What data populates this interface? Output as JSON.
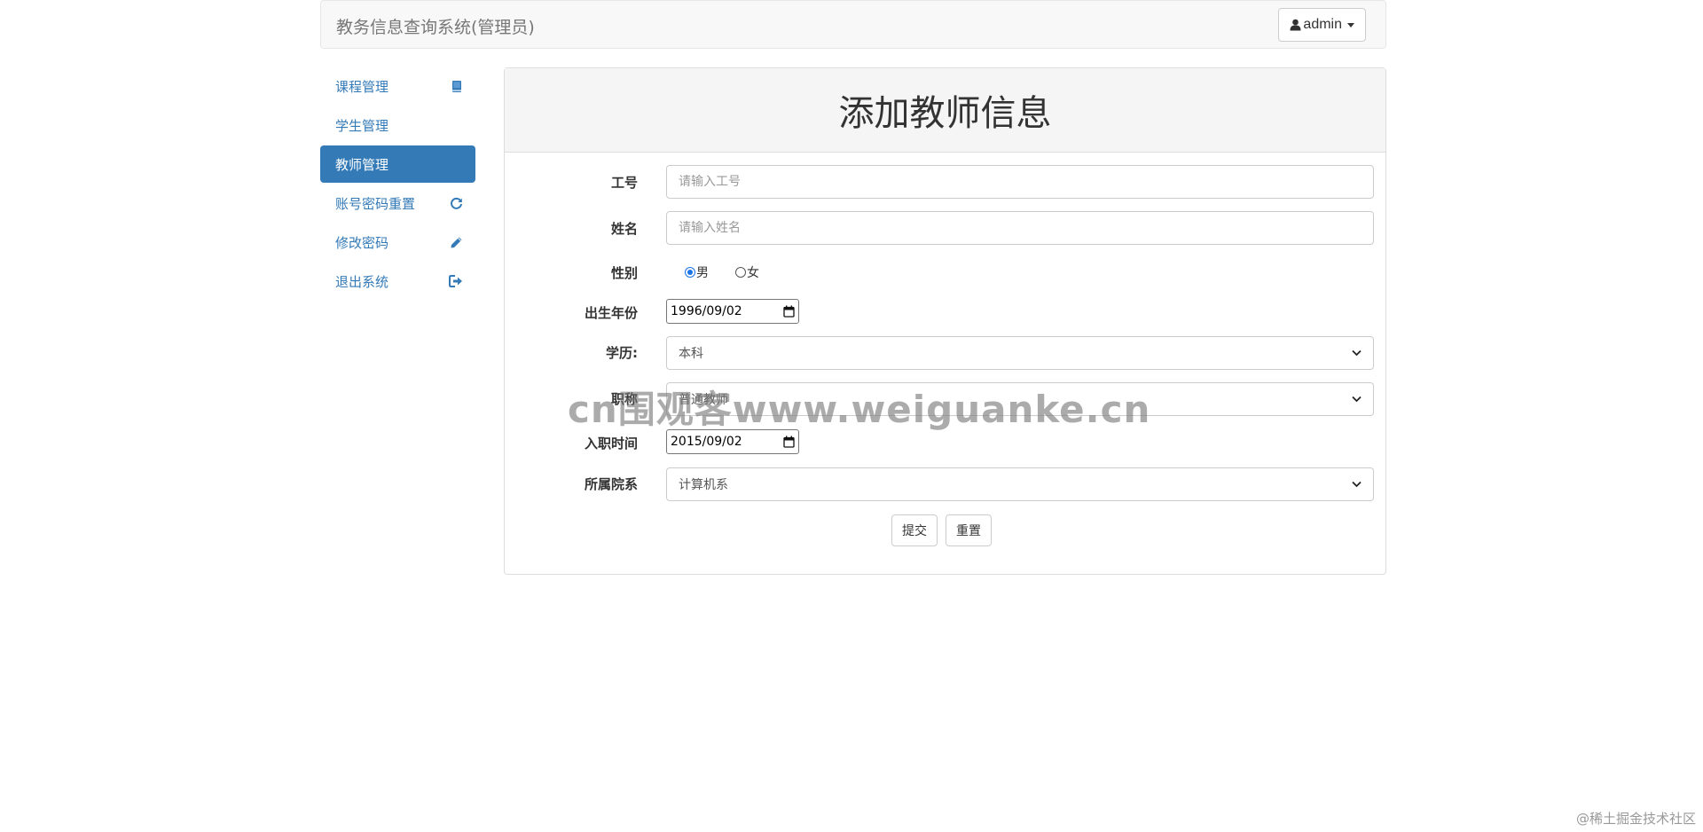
{
  "header": {
    "brand": "教务信息查询系统(管理员)",
    "user_label": "admin"
  },
  "sidebar": {
    "items": [
      {
        "label": "课程管理",
        "icon": "book-icon"
      },
      {
        "label": "学生管理",
        "icon": ""
      },
      {
        "label": "教师管理",
        "icon": "",
        "active": true
      },
      {
        "label": "账号密码重置",
        "icon": "refresh-icon"
      },
      {
        "label": "修改密码",
        "icon": "pencil-icon"
      },
      {
        "label": "退出系统",
        "icon": "logout-icon"
      }
    ]
  },
  "form": {
    "title": "添加教师信息",
    "id_label": "工号",
    "id_placeholder": "请输入工号",
    "name_label": "姓名",
    "name_placeholder": "请输入姓名",
    "gender_label": "性别",
    "gender_options": [
      "男",
      "女"
    ],
    "gender_selected": "男",
    "birth_label": "出生年份",
    "birth_value": "1996/09/02",
    "degree_label": "学历:",
    "degree_value": "本科",
    "title_label": "职称",
    "title_value": "普通教师",
    "hire_label": "入职时间",
    "hire_value": "2015/09/02",
    "dept_label": "所属院系",
    "dept_value": "计算机系",
    "submit_label": "提交",
    "reset_label": "重置"
  },
  "overlay": {
    "watermark": "cn围观客www.weiguanke.cn",
    "corner": "@稀土掘金技术社区"
  },
  "colors": {
    "primary": "#337ab7",
    "radio_checked": "#1a73e8"
  }
}
